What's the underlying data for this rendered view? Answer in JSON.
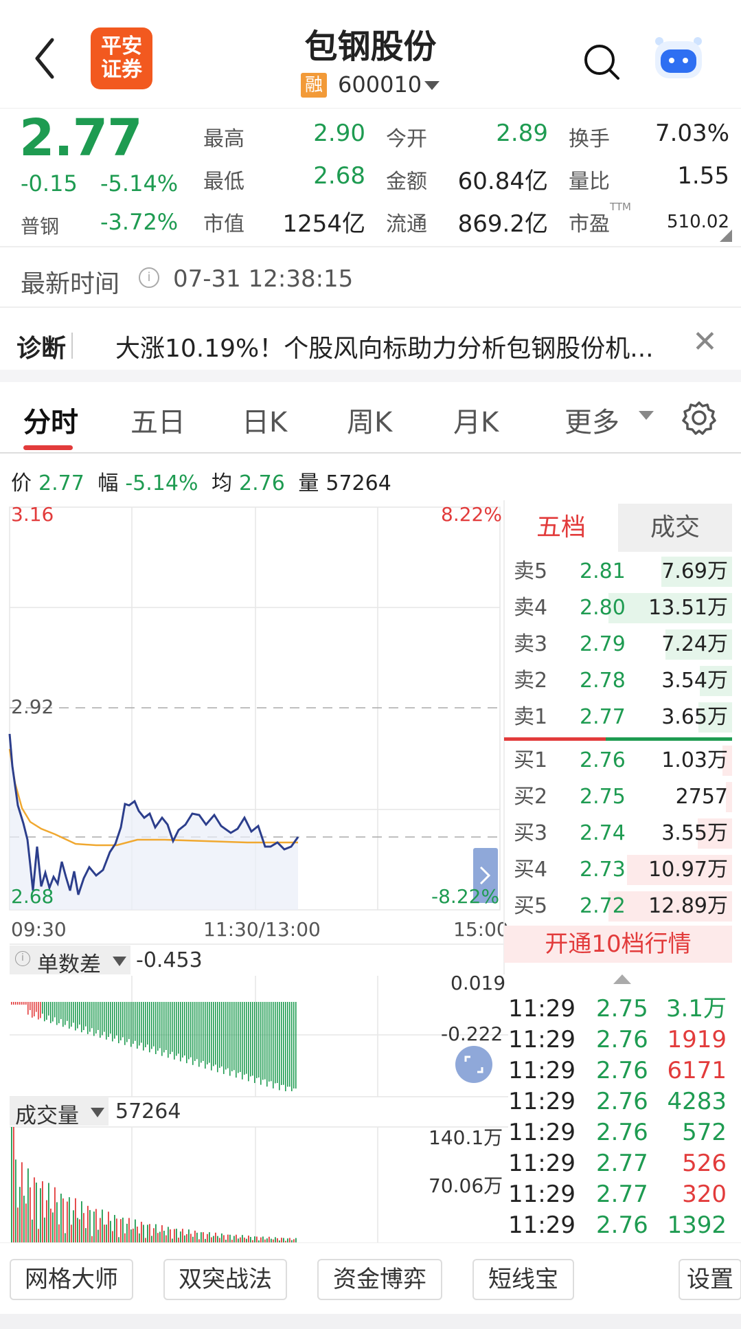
{
  "header": {
    "title": "包钢股份",
    "logo_text_1": "平安",
    "logo_text_2": "证券",
    "badge": "融",
    "code": "600010"
  },
  "quote": {
    "price": "2.77",
    "change": "-0.15",
    "change_pct": "-5.14%",
    "sector_label": "普钢",
    "sector_pct": "-3.72%",
    "fields": [
      {
        "label": "最高",
        "value": "2.90",
        "color": "green"
      },
      {
        "label": "今开",
        "value": "2.89",
        "color": "green"
      },
      {
        "label": "换手",
        "value": "7.03%",
        "color": "dark"
      },
      {
        "label": "最低",
        "value": "2.68",
        "color": "green"
      },
      {
        "label": "金额",
        "value": "60.84亿",
        "color": "dark"
      },
      {
        "label": "量比",
        "value": "1.55",
        "color": "dark"
      },
      {
        "label": "市值",
        "value": "1254亿",
        "color": "dark"
      },
      {
        "label": "流通",
        "value": "869.2亿",
        "color": "dark"
      },
      {
        "label": "市盈",
        "value": "510.02",
        "color": "dark"
      }
    ],
    "pe_sup": "TTM"
  },
  "latest_time": {
    "label": "最新时间",
    "value": "07-31 12:38:15"
  },
  "diagnosis": {
    "label": "诊断",
    "text": "大涨10.19%！个股风向标助力分析包钢股份机..."
  },
  "tabs": [
    "分时",
    "五日",
    "日K",
    "周K",
    "月K",
    "更多"
  ],
  "stats": {
    "price_label": "价",
    "price": "2.77",
    "range_label": "幅",
    "range": "-5.14%",
    "avg_label": "均",
    "avg": "2.76",
    "vol_label": "量",
    "vol": "57264"
  },
  "chart_axes": {
    "y_top": "3.16",
    "y_mid": "2.92",
    "y_bottom": "2.68",
    "pct_top": "8.22%",
    "pct_bottom": "-8.22%",
    "x_start": "09:30",
    "x_mid": "11:30/13:00",
    "x_end": "15:00"
  },
  "indicator1": {
    "name": "单数差",
    "value": "-0.453",
    "top": "0.019",
    "bottom": "-0.222"
  },
  "indicator2": {
    "name": "成交量",
    "value": "57264",
    "top": "140.1万",
    "mid": "70.06万"
  },
  "orderbook": {
    "tab_active": "五档",
    "tab_other": "成交",
    "sell": [
      {
        "label": "卖5",
        "price": "2.81",
        "vol": "7.69万",
        "bar": 0.57
      },
      {
        "label": "卖4",
        "price": "2.80",
        "vol": "13.51万",
        "bar": 1.0
      },
      {
        "label": "卖3",
        "price": "2.79",
        "vol": "7.24万",
        "bar": 0.54
      },
      {
        "label": "卖2",
        "price": "2.78",
        "vol": "3.54万",
        "bar": 0.26
      },
      {
        "label": "卖1",
        "price": "2.77",
        "vol": "3.65万",
        "bar": 0.27
      }
    ],
    "buy": [
      {
        "label": "买1",
        "price": "2.76",
        "vol": "1.03万",
        "bar": 0.08
      },
      {
        "label": "买2",
        "price": "2.75",
        "vol": "2757",
        "bar": 0.02
      },
      {
        "label": "买3",
        "price": "2.74",
        "vol": "3.55万",
        "bar": 0.28
      },
      {
        "label": "买4",
        "price": "2.73",
        "vol": "10.97万",
        "bar": 0.85
      },
      {
        "label": "买5",
        "price": "2.72",
        "vol": "12.89万",
        "bar": 1.0
      }
    ],
    "open10": "开通10档行情"
  },
  "trades": [
    {
      "time": "11:29",
      "price": "2.75",
      "vol": "3.1万",
      "color": "green"
    },
    {
      "time": "11:29",
      "price": "2.76",
      "vol": "1919",
      "color": "red"
    },
    {
      "time": "11:29",
      "price": "2.76",
      "vol": "6171",
      "color": "red"
    },
    {
      "time": "11:29",
      "price": "2.76",
      "vol": "4283",
      "color": "green"
    },
    {
      "time": "11:29",
      "price": "2.76",
      "vol": "572",
      "color": "green"
    },
    {
      "time": "11:29",
      "price": "2.77",
      "vol": "526",
      "color": "red"
    },
    {
      "time": "11:29",
      "price": "2.77",
      "vol": "320",
      "color": "red"
    },
    {
      "time": "11:29",
      "price": "2.76",
      "vol": "1392",
      "color": "green"
    }
  ],
  "bottom_buttons": [
    "网格大师",
    "双突战法",
    "资金博弈",
    "短线宝",
    "设置"
  ],
  "colors": {
    "up": "#e23b3b",
    "down": "#1e9b51",
    "price_line": "#2c3e8c",
    "avg_line": "#f0a830"
  }
}
